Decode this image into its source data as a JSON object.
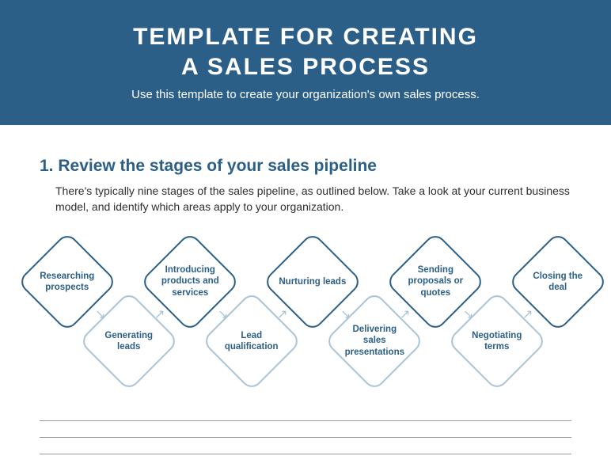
{
  "header": {
    "title_line1": "TEMPLATE FOR CREATING",
    "title_line2": "A SALES PROCESS",
    "subtitle": "Use this template to create your organization's own sales process."
  },
  "section": {
    "heading": "1. Review the stages of your sales pipeline",
    "intro": "There's typically nine stages of the sales pipeline, as outlined below. Take a look at your current business model, and identify which areas apply to your organization."
  },
  "stages": [
    "Researching prospects",
    "Generating leads",
    "Introducing products and services",
    "Lead qualification",
    "Nurturing leads",
    "Delivering sales presentations",
    "Sending proposals or quotes",
    "Negotiating terms",
    "Closing the deal"
  ]
}
